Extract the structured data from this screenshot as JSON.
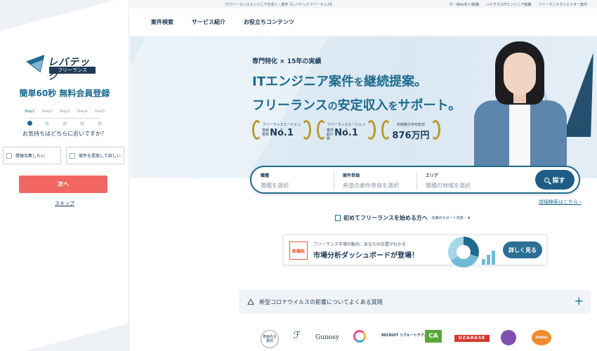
{
  "left_panel": {
    "logo_text": "レバテック",
    "logo_sub": "フリーランス",
    "title": "簡単60秒 無料会員登録",
    "steps": [
      "Step1",
      "Step2",
      "Step3",
      "Step4",
      "Step5"
    ],
    "active_step": 1,
    "question": "お気持ちはどちらに近いですか？",
    "choices": [
      "情報収集したい",
      "案件を提案して欲しい"
    ],
    "next_label": "次へ",
    "skip_label": "スキップ"
  },
  "topbar": {
    "tagline": "ITフリーランスエンジニアの求人・案件【レバテックフリーランス】",
    "links": [
      "IT・Web求人/転職",
      "ハイクラスITエンジニア転職",
      "フリーランスクリエイター案件"
    ]
  },
  "nav": {
    "items": [
      "案件検索",
      "サービス紹介",
      "お役立ちコンテンツ"
    ]
  },
  "hero": {
    "subtitle": "専門特化 × 15年の実績",
    "headline1_a": "ITエンジニア案件",
    "headline1_b": "を",
    "headline1_c": "継続提案",
    "headline1_d": "。",
    "headline2_a": "フリーランス",
    "headline2_b": "の",
    "headline2_c": "安定収入",
    "headline2_d": "を",
    "headline2_e": "サポート",
    "headline2_f": "。",
    "awards": [
      {
        "caption": "フリーランスエージェント",
        "side": "登録者数",
        "value": "No.1"
      },
      {
        "caption": "フリーランスエージェント",
        "side": "案件紹介数",
        "value": "No.1"
      },
      {
        "caption": "利用者の平均年収",
        "side": "",
        "value": "876万円"
      }
    ]
  },
  "search": {
    "fields": [
      {
        "title": "職種",
        "placeholder": "職種を選択"
      },
      {
        "title": "案件単価",
        "placeholder": "希望の案件単価を選択"
      },
      {
        "title": "エリア",
        "placeholder": "職種の地域を選択"
      }
    ],
    "button_label": "探す",
    "detail_link": "詳細検索はこちら ›"
  },
  "first_time": {
    "label": "初めてフリーランスを始める方へ",
    "note": "-充実のサポート内容-",
    "chevron": "›"
  },
  "banner": {
    "badge": "新機能",
    "line1": "フリーランス市場の動向、あなたの位置がわかる",
    "line2": "市場分析ダッシュボードが登場！",
    "button": "詳しく見る"
  },
  "faq": {
    "text": "新型コロナウイルスの影響についてよくある質問",
    "toggle": "+"
  },
  "client_logos": {
    "l1": "参画先企業例",
    "l2": "ℱ",
    "l3": "Gunosy",
    "l5": "RECRUIT リクルートテクノロジーズ",
    "l6": "CA",
    "l7": "UZABASE",
    "l9": "BANDAI NAMCO"
  },
  "colors": {
    "brand_blue": "#1e6b8f",
    "navy": "#1f3b57",
    "cta_red": "#f26762",
    "hero_bg": "#dbe8f2"
  }
}
